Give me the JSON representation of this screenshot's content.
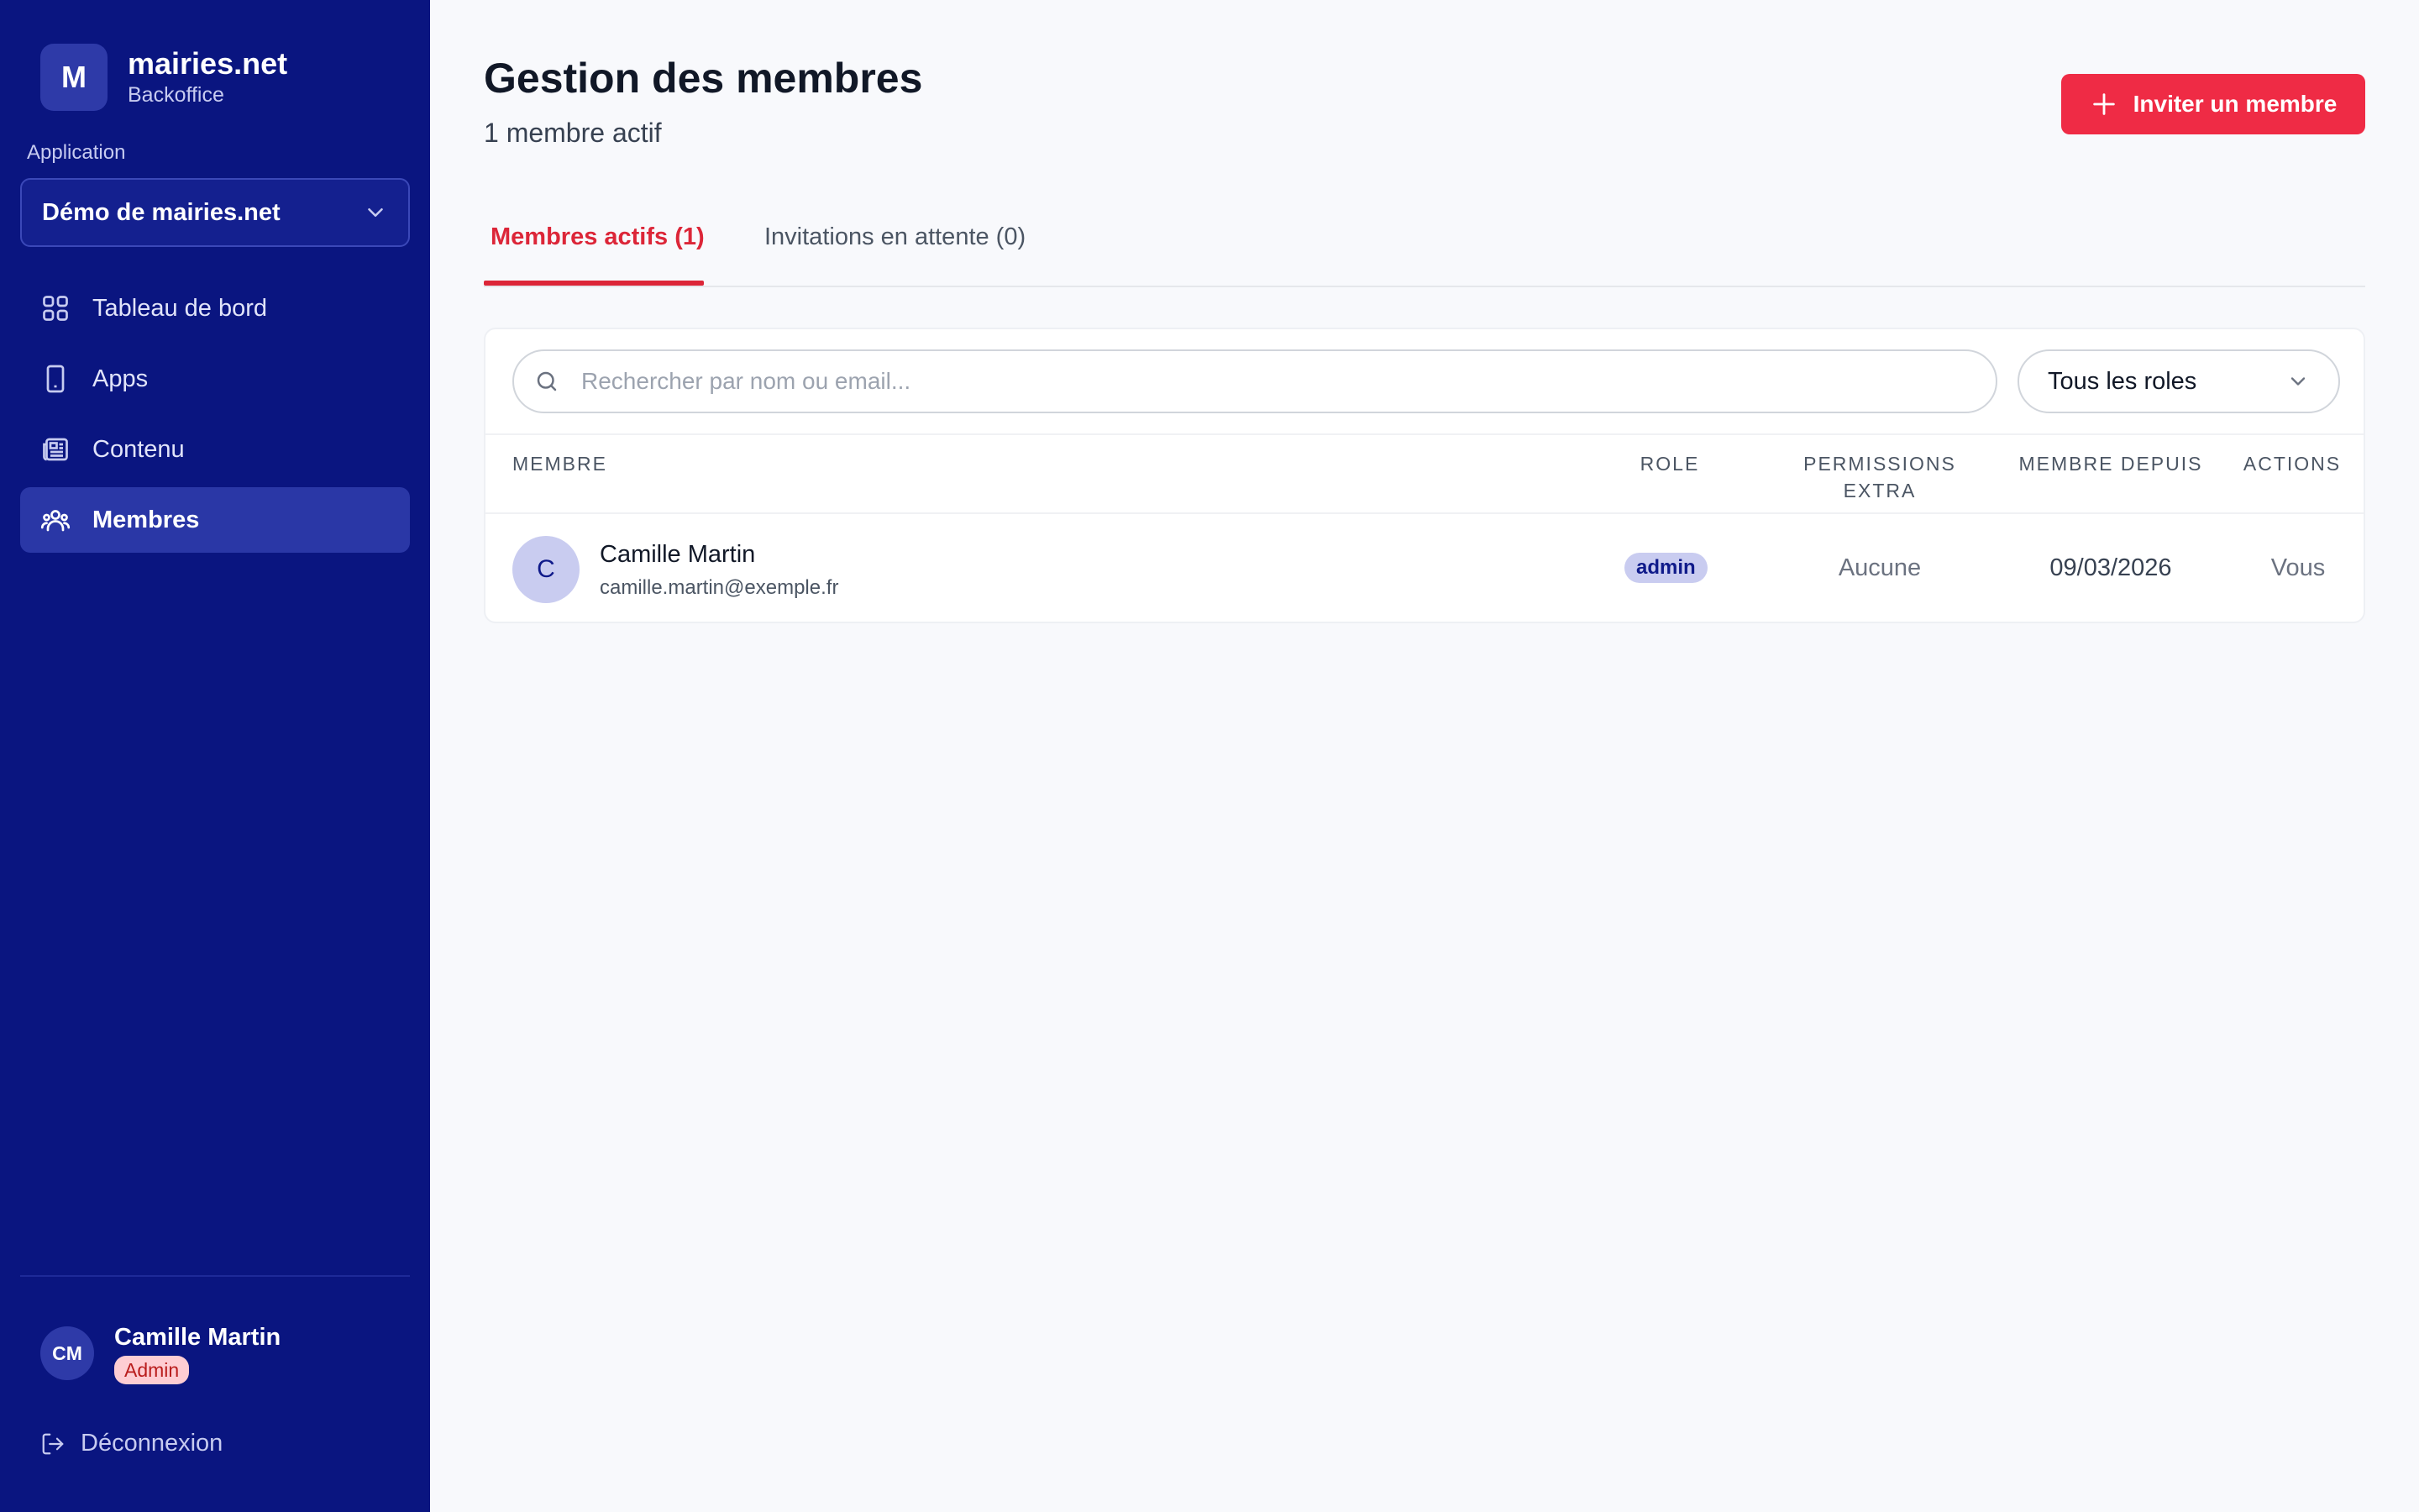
{
  "brand": {
    "logo_letter": "M",
    "name": "mairies.net",
    "subtitle": "Backoffice"
  },
  "application": {
    "label": "Application",
    "selected": "Démo de mairies.net"
  },
  "nav": {
    "items": [
      {
        "label": "Tableau de bord",
        "icon": "grid-icon",
        "active": false
      },
      {
        "label": "Apps",
        "icon": "phone-icon",
        "active": false
      },
      {
        "label": "Contenu",
        "icon": "newspaper-icon",
        "active": false
      },
      {
        "label": "Membres",
        "icon": "users-icon",
        "active": true
      }
    ]
  },
  "user": {
    "initials": "CM",
    "name": "Camille Martin",
    "role": "Admin"
  },
  "logout": {
    "label": "Déconnexion"
  },
  "page": {
    "title": "Gestion des membres",
    "subtitle": "1 membre actif"
  },
  "invite_button": {
    "label": "Inviter un membre"
  },
  "tabs": [
    {
      "label": "Membres actifs (1)",
      "active": true
    },
    {
      "label": "Invitations en attente (0)",
      "active": false
    }
  ],
  "filters": {
    "search_placeholder": "Rechercher par nom ou email...",
    "role_selected": "Tous les roles"
  },
  "table": {
    "columns": [
      "MEMBRE",
      "ROLE",
      "PERMISSIONS EXTRA",
      "MEMBRE DEPUIS",
      "ACTIONS"
    ],
    "rows": [
      {
        "initial": "C",
        "name": "Camille Martin",
        "email": "camille.martin@exemple.fr",
        "role": "admin",
        "permissions": "Aucune",
        "since": "09/03/2026",
        "actions": "Vous"
      }
    ]
  },
  "colors": {
    "sidebar": "#0a1580",
    "accent_red": "#ef2b45",
    "tab_active": "#dc2638",
    "badge_role": "#c9ccf0"
  }
}
